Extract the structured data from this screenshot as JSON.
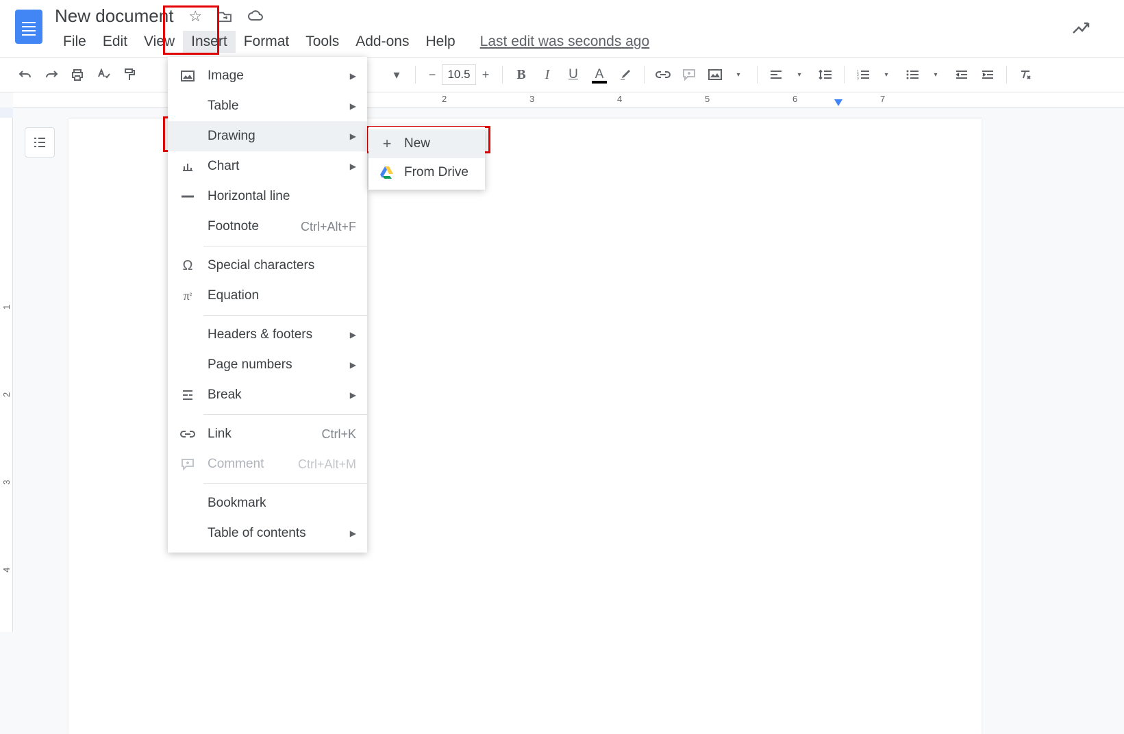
{
  "header": {
    "doc_title": "New document",
    "last_edit": "Last edit was seconds ago"
  },
  "menubar": {
    "file": "File",
    "edit": "Edit",
    "view": "View",
    "insert": "Insert",
    "format": "Format",
    "tools": "Tools",
    "addons": "Add-ons",
    "help": "Help"
  },
  "toolbar": {
    "font_size": "10.5"
  },
  "ruler": {
    "n2": "2",
    "n3": "3",
    "n4": "4",
    "n5": "5",
    "n6": "6",
    "n7": "7"
  },
  "vruler": {
    "n1": "1",
    "n2": "2",
    "n3": "3",
    "n4": "4"
  },
  "insert_menu": {
    "image": "Image",
    "table": "Table",
    "drawing": "Drawing",
    "chart": "Chart",
    "horizontal_line": "Horizontal line",
    "footnote": "Footnote",
    "footnote_sc": "Ctrl+Alt+F",
    "special_chars": "Special characters",
    "equation": "Equation",
    "headers_footers": "Headers & footers",
    "page_numbers": "Page numbers",
    "break": "Break",
    "link": "Link",
    "link_sc": "Ctrl+K",
    "comment": "Comment",
    "comment_sc": "Ctrl+Alt+M",
    "bookmark": "Bookmark",
    "toc": "Table of contents"
  },
  "drawing_submenu": {
    "new": "New",
    "from_drive": "From Drive"
  }
}
